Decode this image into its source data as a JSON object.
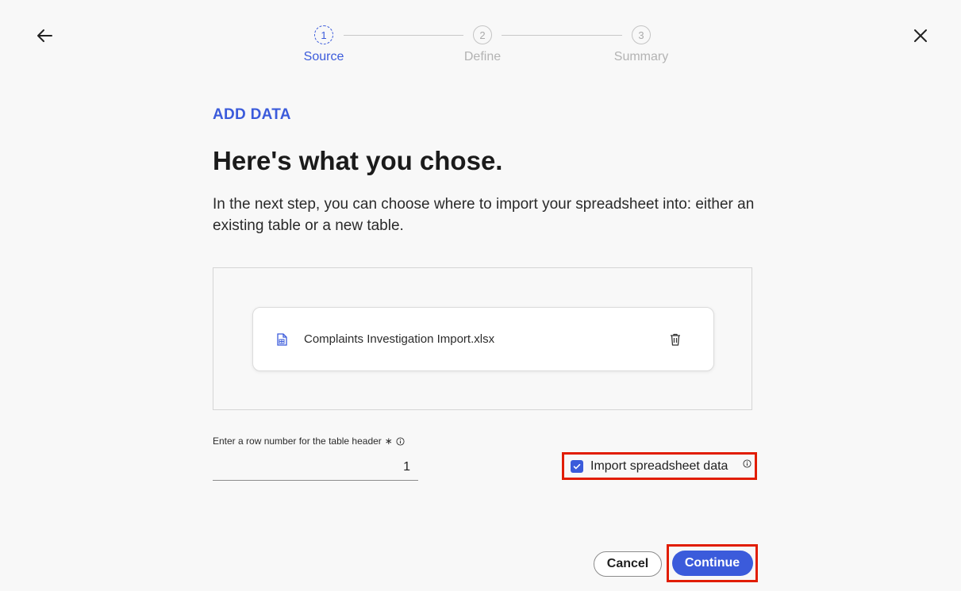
{
  "nav": {
    "back_icon": "arrow-left-icon",
    "close_icon": "close-icon"
  },
  "stepper": {
    "steps": [
      {
        "number": "1",
        "label": "Source",
        "active": true
      },
      {
        "number": "2",
        "label": "Define",
        "active": false
      },
      {
        "number": "3",
        "label": "Summary",
        "active": false
      }
    ]
  },
  "main": {
    "eyebrow": "ADD DATA",
    "heading": "Here's what you chose.",
    "description": "In the next step, you can choose where to import your spreadsheet into: either an existing table or a new table."
  },
  "file": {
    "name": "Complaints Investigation Import.xlsx",
    "icon": "spreadsheet-file-icon",
    "delete_icon": "trash-icon"
  },
  "header_row": {
    "label": "Enter a row number for the table header",
    "required_mark": "∗",
    "value": "1"
  },
  "import_option": {
    "label": "Import spreadsheet data",
    "checked": true
  },
  "actions": {
    "cancel_label": "Cancel",
    "continue_label": "Continue"
  },
  "colors": {
    "accent": "#3b5bdb",
    "highlight": "#e11d00",
    "background": "#f8f8f8"
  }
}
